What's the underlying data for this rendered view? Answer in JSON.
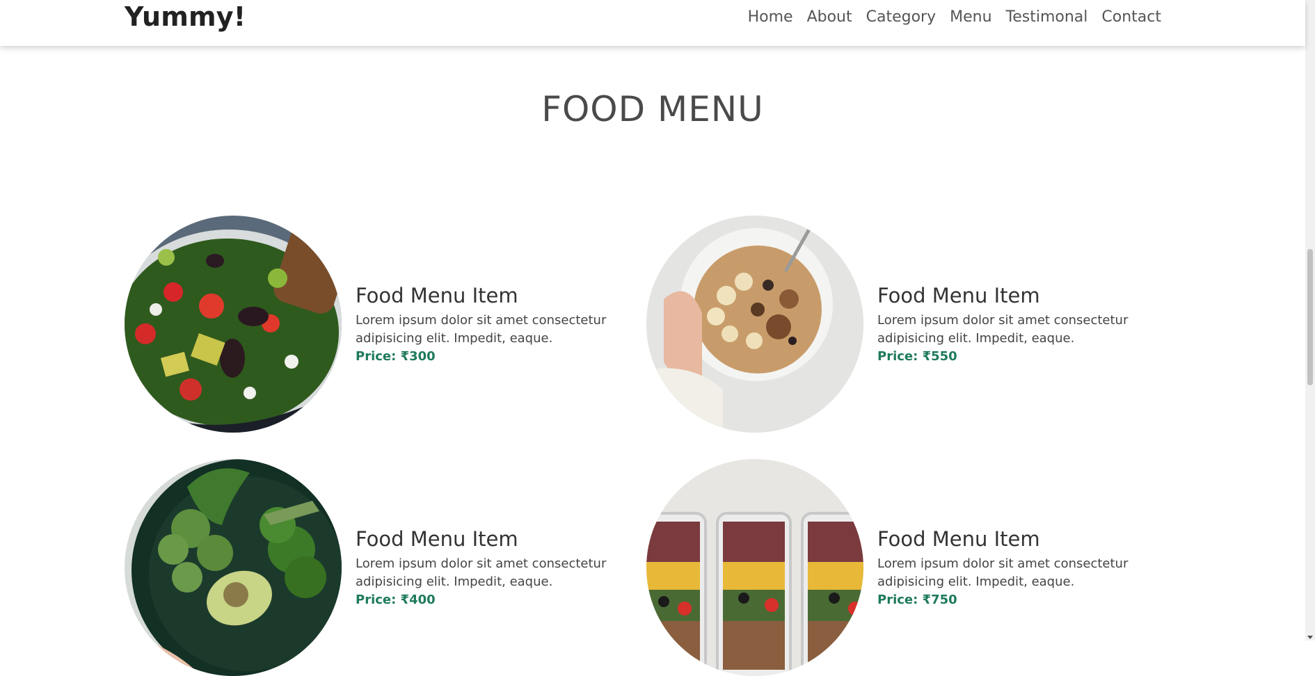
{
  "brand": {
    "name": "Yummy!"
  },
  "nav": {
    "items": [
      {
        "label": "Home"
      },
      {
        "label": "About"
      },
      {
        "label": "Category"
      },
      {
        "label": "Menu"
      },
      {
        "label": "Testimonal"
      },
      {
        "label": "Contact"
      }
    ]
  },
  "section": {
    "title": "FOOD MENU"
  },
  "menu_items": [
    {
      "title": "Food Menu Item",
      "desc_line1": "Lorem ipsum dolor sit amet consectetur",
      "desc_line2": "adipisicing elit. Impedit, eaque.",
      "price": "Price: ₹300",
      "image": "salad-bowl"
    },
    {
      "title": "Food Menu Item",
      "desc_line1": "Lorem ipsum dolor sit amet consectetur",
      "desc_line2": "adipisicing elit. Impedit, eaque.",
      "price": "Price: ₹550",
      "image": "granola-bowl"
    },
    {
      "title": "Food Menu Item",
      "desc_line1": "Lorem ipsum dolor sit amet consectetur",
      "desc_line2": "adipisicing elit. Impedit, eaque.",
      "price": "Price: ₹400",
      "image": "vegetable-bowl"
    },
    {
      "title": "Food Menu Item",
      "desc_line1": "Lorem ipsum dolor sit amet consectetur",
      "desc_line2": "adipisicing elit. Impedit, eaque.",
      "price": "Price: ₹750",
      "image": "meal-prep-containers"
    }
  ],
  "colors": {
    "price": "#1e7a5c",
    "title": "#4a4a4a",
    "nav_text": "#555555"
  }
}
